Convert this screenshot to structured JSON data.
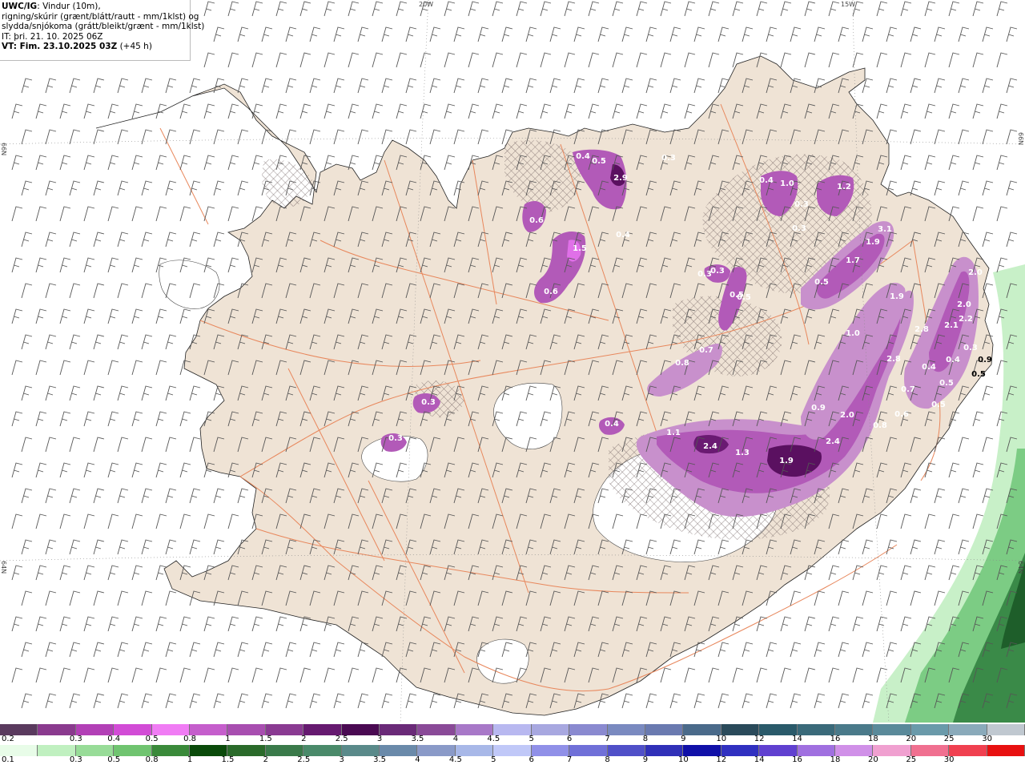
{
  "header": {
    "title_bold": "UWC/IG",
    "title_rest": ": Vindur (10m),",
    "line2": "rigning/skúrir (grænt/blátt/rautt - mm/1klst) og",
    "line3": "slydda/snjókoma (grátt/bleikt/grænt - mm/1klst)",
    "it_line": "IT: þri. 21. 10. 2025 06Z",
    "vt_bold": "VT: Fim. 23.10.2025 03Z",
    "vt_rest": " (+45 h)"
  },
  "coords": {
    "lon_20w": "20W",
    "lon_15w": "15W",
    "lat_66n_left": "66N",
    "lat_66n_right": "66N",
    "lat_64n_left": "64N",
    "lat_64n_right": "64N"
  },
  "precip_values": [
    {
      "text": "0.4"
    },
    {
      "text": "0.5"
    },
    {
      "text": "2.9"
    },
    {
      "text": "0.3"
    },
    {
      "text": "0.6"
    },
    {
      "text": "1.5"
    },
    {
      "text": "0.4"
    },
    {
      "text": "0.6"
    },
    {
      "text": "0.4"
    },
    {
      "text": "1.0"
    },
    {
      "text": "0.3"
    },
    {
      "text": "0.3"
    },
    {
      "text": "1.2"
    },
    {
      "text": "3.1"
    },
    {
      "text": "1.9"
    },
    {
      "text": "1.7"
    },
    {
      "text": "0.5"
    },
    {
      "text": "1.9"
    },
    {
      "text": "1.0"
    },
    {
      "text": "0.3"
    },
    {
      "text": "0.3"
    },
    {
      "text": "0.5"
    },
    {
      "text": "0.7"
    },
    {
      "text": "0.8"
    },
    {
      "text": "2.0"
    },
    {
      "text": "2.0"
    },
    {
      "text": "2.2"
    },
    {
      "text": "2.1"
    },
    {
      "text": "2.8"
    },
    {
      "text": "2.8"
    },
    {
      "text": "0.4"
    },
    {
      "text": "0.4"
    },
    {
      "text": "0.5"
    },
    {
      "text": "0.7"
    },
    {
      "text": "0.5"
    },
    {
      "text": "0.3"
    },
    {
      "text": "0.9"
    },
    {
      "text": "0.6"
    },
    {
      "text": "2.0"
    },
    {
      "text": "0.8"
    },
    {
      "text": "1.1"
    },
    {
      "text": "2.4"
    },
    {
      "text": "1.3"
    },
    {
      "text": "1.9"
    },
    {
      "text": "2.4"
    },
    {
      "text": "0.4"
    },
    {
      "text": "0.3"
    },
    {
      "text": "0.3"
    },
    {
      "text": "0.5"
    },
    {
      "text": "0.9"
    },
    {
      "text": "0.5"
    }
  ],
  "legend_snow": {
    "colors": [
      "#5a3a5e",
      "#8a3a8e",
      "#b240b6",
      "#d24cd6",
      "#f07cf4",
      "#c55ecc",
      "#a84eb0",
      "#8a3a92",
      "#661a70",
      "#4a0a52",
      "#6a2a78",
      "#8a4a98",
      "#a878c8",
      "#b8b8f0",
      "#a8a8e0",
      "#8a8ad0",
      "#7a8ac0",
      "#6a7ab0",
      "#4a6a8a",
      "#2a4a5a",
      "#2a5a6a",
      "#3a6a7a",
      "#4a7a8a",
      "#5a8a9a",
      "#6a9aaa",
      "#8aaaba",
      "#c0c8d0"
    ],
    "labels": [
      "0.2",
      "0.3",
      "0.4",
      "0.5",
      "0.8",
      "1",
      "1.5",
      "2",
      "2.5",
      "3",
      "3.5",
      "4",
      "4.5",
      "5",
      "6",
      "7",
      "8",
      "9",
      "10",
      "12",
      "14",
      "16",
      "18",
      "20",
      "25",
      "30"
    ]
  },
  "legend_rain": {
    "colors": [
      "#e8fce8",
      "#c0f0c0",
      "#98dc98",
      "#70c470",
      "#3a8a3a",
      "#0a4a0a",
      "#2a6a2a",
      "#3a7a4a",
      "#4a8a6a",
      "#5a8a8a",
      "#6a8aaa",
      "#8a9ac8",
      "#a8b8e8",
      "#c0c8f8",
      "#9090e8",
      "#7070d8",
      "#5050c8",
      "#3030b8",
      "#1010a8",
      "#3030c0",
      "#6040d0",
      "#a070e0",
      "#d090e8",
      "#f0a0d0",
      "#f07090",
      "#f04050",
      "#e81010"
    ],
    "labels": [
      "0.1",
      "0.3",
      "0.5",
      "0.8",
      "1",
      "1.5",
      "2",
      "2.5",
      "3",
      "3.5",
      "4",
      "4.5",
      "5",
      "6",
      "7",
      "8",
      "9",
      "10",
      "12",
      "14",
      "16",
      "18",
      "20",
      "25",
      "30"
    ]
  },
  "colors": {
    "land": "#efe3d5",
    "glacier": "#ffffff",
    "roads": "#e8875c",
    "precip_light": "#c890cc",
    "precip_mid": "#b25ab8",
    "precip_strong": "#8a2a92",
    "precip_peak": "#5a1060",
    "rain_light": "#c8f0c8",
    "rain_mid": "#7ccc84",
    "rain_dark": "#3a8a48",
    "barb": "#555555"
  }
}
